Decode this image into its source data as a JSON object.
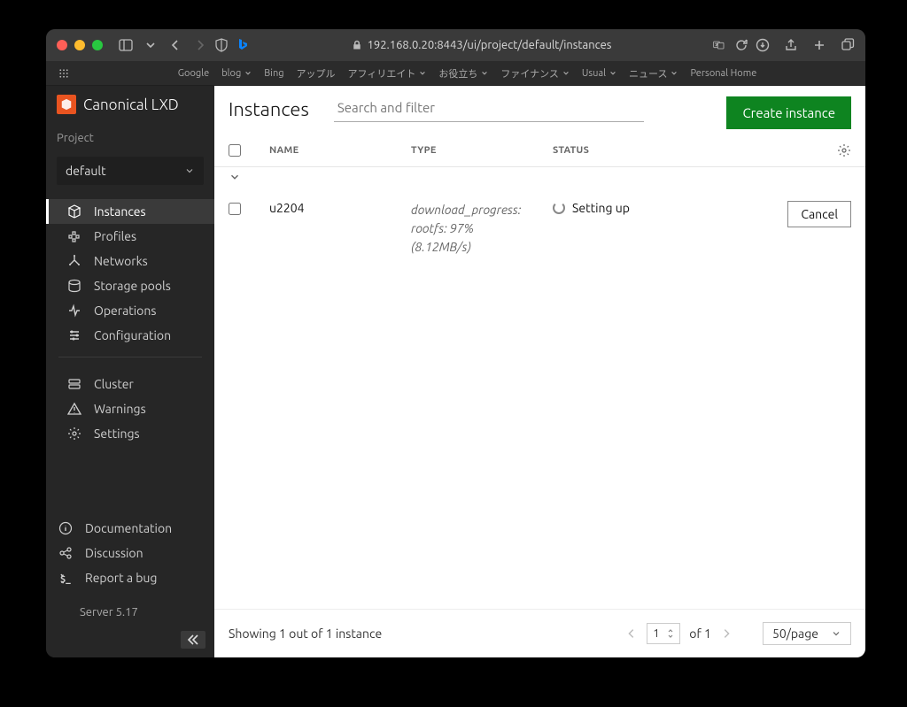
{
  "chrome": {
    "url": "192.168.0.20:8443/ui/project/default/instances"
  },
  "bookmarks": [
    "Google",
    "blog",
    "Bing",
    "アップル",
    "アフィリエイト",
    "お役立ち",
    "ファイナンス",
    "Usual",
    "ニュース",
    "Personal Home"
  ],
  "bookmarks_dropdown": [
    false,
    true,
    false,
    false,
    true,
    true,
    true,
    true,
    true,
    false
  ],
  "sidebar": {
    "brand": "Canonical LXD",
    "project_label": "Project",
    "project_value": "default",
    "nav": [
      {
        "key": "instances",
        "label": "Instances"
      },
      {
        "key": "profiles",
        "label": "Profiles"
      },
      {
        "key": "networks",
        "label": "Networks"
      },
      {
        "key": "storage",
        "label": "Storage pools"
      },
      {
        "key": "operations",
        "label": "Operations"
      },
      {
        "key": "configuration",
        "label": "Configuration"
      }
    ],
    "nav2": [
      {
        "key": "cluster",
        "label": "Cluster"
      },
      {
        "key": "warnings",
        "label": "Warnings"
      },
      {
        "key": "settings",
        "label": "Settings"
      }
    ],
    "footer": [
      {
        "key": "documentation",
        "label": "Documentation"
      },
      {
        "key": "discussion",
        "label": "Discussion"
      },
      {
        "key": "reportbug",
        "label": "Report a bug"
      }
    ],
    "server": "Server 5.17"
  },
  "main": {
    "title": "Instances",
    "search_placeholder": "Search and filter",
    "create_button": "Create instance",
    "columns": {
      "name": "NAME",
      "type": "TYPE",
      "status": "STATUS"
    },
    "row": {
      "name": "u2204",
      "type_line1": "download_progress:",
      "type_line2": "rootfs: 97%",
      "type_line3": "(8.12MB/s)",
      "status": "Setting up",
      "cancel": "Cancel"
    },
    "footer_text": "Showing 1 out of 1 instance",
    "pager": {
      "page": "1",
      "of_label": "of 1",
      "perpage": "50/page"
    }
  }
}
